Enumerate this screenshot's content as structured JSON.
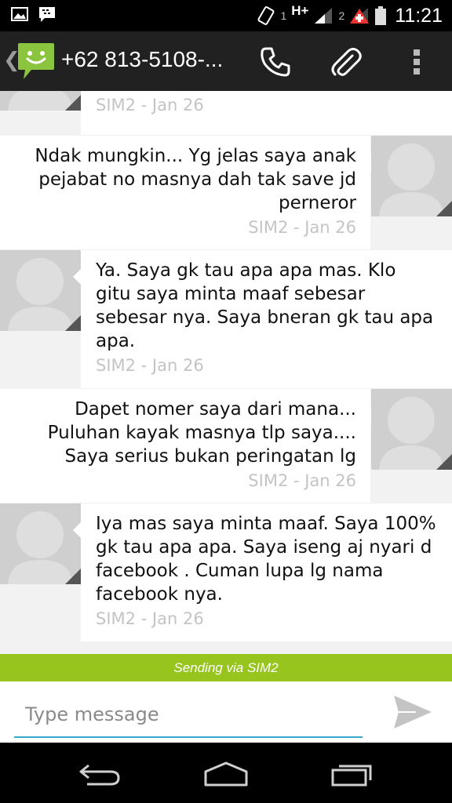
{
  "status_bar": {
    "sim1_label": "1",
    "network_type": "H+",
    "sim2_label": "2",
    "time": "11:21",
    "icons": [
      "gallery-icon",
      "bbm-icon",
      "vibrate-icon",
      "signal-sim1-icon",
      "signal-sim2-icon",
      "alert-icon",
      "battery-icon"
    ]
  },
  "header": {
    "contact": "+62 813-5108-...",
    "icons": [
      "back-icon",
      "messaging-app-icon",
      "phone-icon",
      "attachment-icon",
      "overflow-menu-icon"
    ]
  },
  "messages": [
    {
      "direction": "in",
      "text": "",
      "meta": "SIM2 - Jan 26"
    },
    {
      "direction": "out",
      "text": "Ndak mungkin... Yg jelas saya anak\npejabat no masnya dah tak save jd\nperneror",
      "meta": "SIM2 - Jan 26"
    },
    {
      "direction": "in",
      "text": "Ya.  Saya gk tau apa apa mas. Klo\ngitu saya minta maaf sebesar\nsebesar nya. Saya bneran gk tau apa\napa.",
      "meta": "SIM2 - Jan 26"
    },
    {
      "direction": "out",
      "text": "Dapet nomer saya dari mana...\nPuluhan kayak masnya tlp saya....\nSaya serius bukan peringatan lg",
      "meta": "SIM2 - Jan 26"
    },
    {
      "direction": "in",
      "text": "Iya mas saya minta maaf.  Saya 100%\ngk tau apa apa. Saya iseng aj nyari d\nfacebook . Cuman lupa lg nama\nfacebook nya.",
      "meta": "SIM2 - Jan 26"
    }
  ],
  "sending_bar": {
    "label": "Sending via SIM2"
  },
  "compose": {
    "placeholder": "Type message"
  },
  "colors": {
    "action_bar": "#212121",
    "sim_bar": "#97c51d",
    "input_underline": "#34a9c9",
    "meta_text": "#c4c4c4"
  },
  "nav": {
    "icons": [
      "back-nav-icon",
      "home-nav-icon",
      "recents-nav-icon"
    ]
  }
}
